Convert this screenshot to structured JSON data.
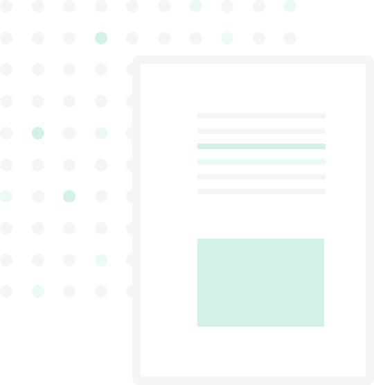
{
  "colors": {
    "background": "#ffffff",
    "neutral": "#f5f5f5",
    "accent": "#d4f1e6",
    "accent_light": "#ebfaf4"
  },
  "icons": [
    "document-illustration",
    "dot-pattern"
  ],
  "dot_pattern": {
    "rows": 10,
    "columns": 10,
    "accent_dots": [
      {
        "row": 1,
        "column": 3
      },
      {
        "row": 4,
        "column": 1
      },
      {
        "row": 6,
        "column": 2
      }
    ],
    "accent_light_dots": [
      {
        "row": 0,
        "column": 6
      },
      {
        "row": 0,
        "column": 9
      },
      {
        "row": 1,
        "column": 7
      },
      {
        "row": 4,
        "column": 3
      },
      {
        "row": 6,
        "column": 0
      },
      {
        "row": 8,
        "column": 3
      },
      {
        "row": 9,
        "column": 1
      }
    ]
  },
  "document": {
    "line_styles": [
      "neutral",
      "neutral",
      "accent",
      "accent-light",
      "neutral",
      "neutral"
    ]
  }
}
